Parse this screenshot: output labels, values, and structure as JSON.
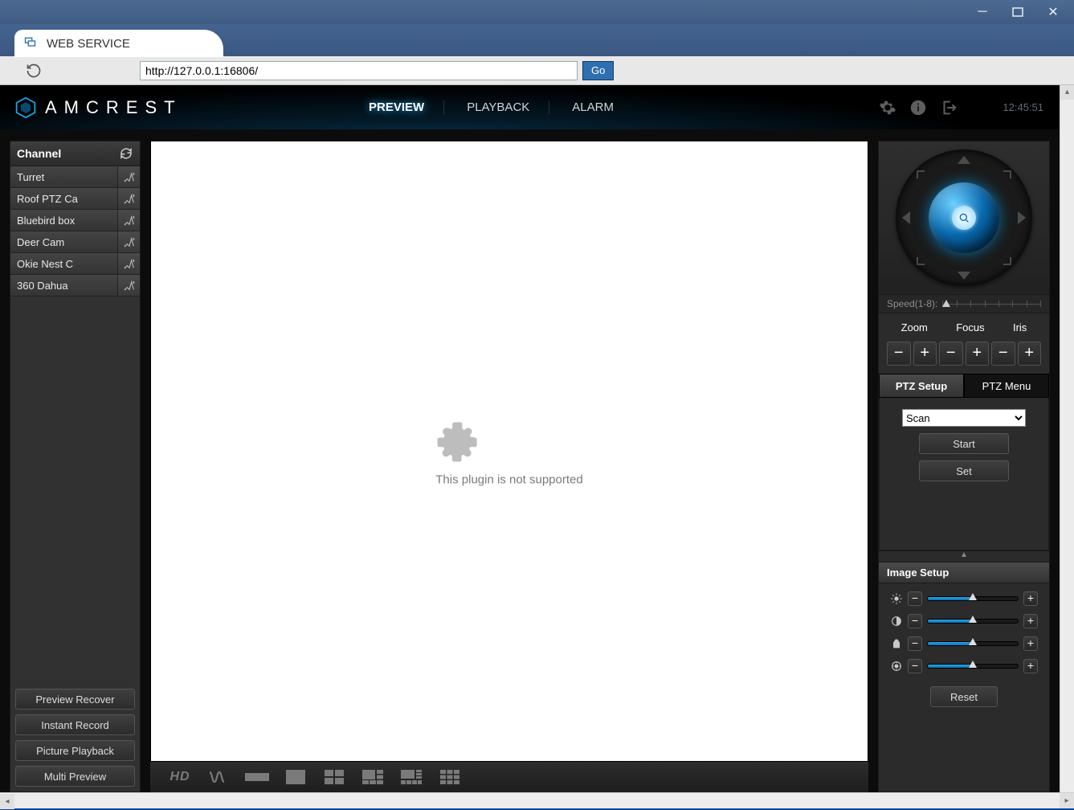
{
  "window": {
    "tab_title": "WEB SERVICE"
  },
  "address_bar": {
    "url": "http://127.0.0.1:16806/",
    "go_label": "Go"
  },
  "header": {
    "brand": "AMCREST",
    "nav": {
      "preview": "PREVIEW",
      "playback": "PLAYBACK",
      "alarm": "ALARM"
    },
    "clock": "12:45:51"
  },
  "channels": {
    "title": "Channel",
    "items": [
      {
        "name": "Turret"
      },
      {
        "name": "Roof PTZ Ca"
      },
      {
        "name": "Bluebird box"
      },
      {
        "name": "Deer Cam"
      },
      {
        "name": "Okie Nest C"
      },
      {
        "name": "360 Dahua"
      }
    ]
  },
  "left_buttons": {
    "preview_recover": "Preview Recover",
    "instant_record": "Instant Record",
    "picture_playback": "Picture Playback",
    "multi_preview": "Multi Preview"
  },
  "video": {
    "plugin_message": "This plugin is not supported"
  },
  "toolbar": {
    "hd_label": "HD"
  },
  "ptz": {
    "speed_label": "Speed(1-8):",
    "zoom_label": "Zoom",
    "focus_label": "Focus",
    "iris_label": "Iris",
    "tab_setup": "PTZ Setup",
    "tab_menu": "PTZ Menu",
    "select_value": "Scan",
    "start_label": "Start",
    "set_label": "Set"
  },
  "image_setup": {
    "title": "Image Setup",
    "reset_label": "Reset"
  }
}
